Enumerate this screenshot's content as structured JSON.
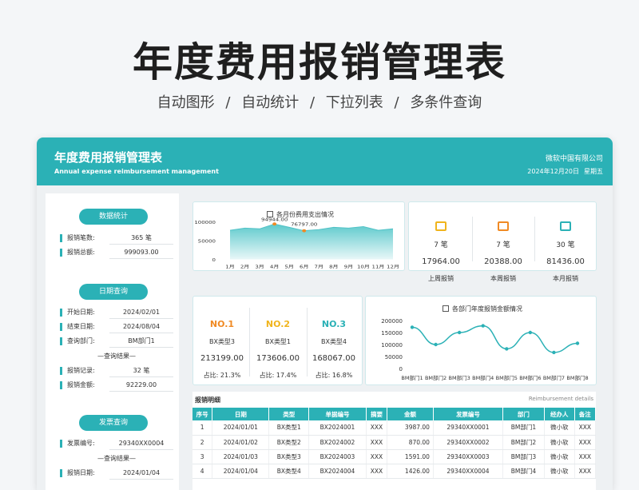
{
  "hero": {
    "title": "年度费用报销管理表",
    "features": [
      "自动图形",
      "自动统计",
      "下拉列表",
      "多条件查询"
    ],
    "sep": "/"
  },
  "header": {
    "title": "年度费用报销管理表",
    "subtitle": "Annual expense reimbursement management",
    "company": "微软中国有限公司",
    "date": "2024年12月20日",
    "weekday": "星期五"
  },
  "colors": {
    "accent": "#2bb1b6",
    "no1": "#f08a24",
    "no2": "#f0b41c",
    "no3": "#2bb1b6"
  },
  "left": {
    "stats_label": "数据统计",
    "count_label": "报销笔数:",
    "count_value": "365 笔",
    "total_label": "报销总额:",
    "total_value": "999093.00",
    "date_query_label": "日期查询",
    "start_label": "开始日期:",
    "start_value": "2024/02/01",
    "end_label": "结束日期:",
    "end_value": "2024/08/04",
    "dept_label": "查询部门:",
    "dept_value": "BM部门1",
    "result_label": "—查询结果—",
    "rec_label": "报销记录:",
    "rec_value": "32 笔",
    "amt_label": "报销金额:",
    "amt_value": "92229.00",
    "invoice_query_label": "发票查询",
    "inv_label": "发票编号:",
    "inv_value": "29340XX0004",
    "result2_label": "—查询结果—",
    "rdate_label": "报销日期:",
    "rdate_value": "2024/01/04"
  },
  "summary": [
    {
      "icon": "wallet-icon",
      "color": "#f0b41c",
      "count": "7 笔",
      "amount": "17964.00",
      "label": "上周报销"
    },
    {
      "icon": "wallet-icon",
      "color": "#f08a24",
      "count": "7 笔",
      "amount": "20388.00",
      "label": "本周报销"
    },
    {
      "icon": "wallet-icon",
      "color": "#2bb1b6",
      "count": "30 笔",
      "amount": "81436.00",
      "label": "本月报销"
    }
  ],
  "ranks": [
    {
      "no": "NO.1",
      "type": "BX类型3",
      "amount": "213199.00",
      "pct": "占比:  21.3%"
    },
    {
      "no": "NO.2",
      "type": "BX类型1",
      "amount": "173606.00",
      "pct": "占比:  17.4%"
    },
    {
      "no": "NO.3",
      "type": "BX类型4",
      "amount": "168067.00",
      "pct": "占比:  16.8%"
    }
  ],
  "chart_data": [
    {
      "type": "area",
      "title": "各月份费用支出情况",
      "categories": [
        "1月",
        "2月",
        "3月",
        "4月",
        "5月",
        "6月",
        "7月",
        "8月",
        "9月",
        "10月",
        "11月",
        "12月"
      ],
      "values": [
        78000,
        84000,
        82000,
        94944,
        86000,
        76797,
        80000,
        86000,
        84000,
        88000,
        78000,
        82000
      ],
      "yticks": [
        "100000",
        "50000",
        "0"
      ],
      "ylim": [
        0,
        100000
      ],
      "annotations": [
        "94944.00",
        "76797.00"
      ],
      "grid": false
    },
    {
      "type": "line",
      "title": "各部门年度报销金额情况",
      "categories": [
        "BM部门1",
        "BM部门2",
        "BM部门3",
        "BM部门4",
        "BM部门5",
        "BM部门6",
        "BM部门7",
        "BM部门8"
      ],
      "values": [
        172000,
        100000,
        150000,
        178000,
        82000,
        150000,
        67000,
        105000
      ],
      "yticks": [
        "200000",
        "150000",
        "100000",
        "50000",
        "0"
      ],
      "ylim": [
        0,
        200000
      ],
      "grid": false
    }
  ],
  "detail": {
    "title": "报销明细",
    "subtitle": "Reimbursement details",
    "columns": [
      "序号",
      "日期",
      "类型",
      "单据编号",
      "摘要",
      "金额",
      "发票编号",
      "部门",
      "经办人",
      "备注"
    ],
    "rows": [
      [
        "1",
        "2024/01/01",
        "BX类型1",
        "BX2024001",
        "XXX",
        "3987.00",
        "29340XX0001",
        "BM部门1",
        "微小软",
        "XXX"
      ],
      [
        "2",
        "2024/01/02",
        "BX类型2",
        "BX2024002",
        "XXX",
        "870.00",
        "29340XX0002",
        "BM部门2",
        "微小软",
        "XXX"
      ],
      [
        "3",
        "2024/01/03",
        "BX类型3",
        "BX2024003",
        "XXX",
        "1591.00",
        "29340XX0003",
        "BM部门3",
        "微小软",
        "XXX"
      ],
      [
        "4",
        "2024/01/04",
        "BX类型4",
        "BX2024004",
        "XXX",
        "1426.00",
        "29340XX0004",
        "BM部门4",
        "微小软",
        "XXX"
      ]
    ]
  }
}
